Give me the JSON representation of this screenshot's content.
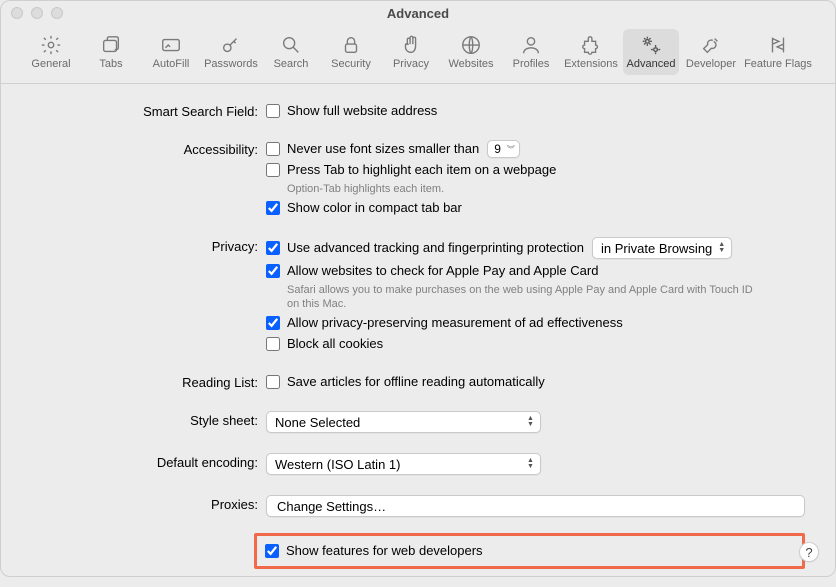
{
  "window": {
    "title": "Advanced"
  },
  "toolbar": {
    "items": [
      {
        "label": "General"
      },
      {
        "label": "Tabs"
      },
      {
        "label": "AutoFill"
      },
      {
        "label": "Passwords"
      },
      {
        "label": "Search"
      },
      {
        "label": "Security"
      },
      {
        "label": "Privacy"
      },
      {
        "label": "Websites"
      },
      {
        "label": "Profiles"
      },
      {
        "label": "Extensions"
      },
      {
        "label": "Advanced"
      },
      {
        "label": "Developer"
      },
      {
        "label": "Feature Flags"
      }
    ]
  },
  "sections": {
    "smart_search": {
      "label": "Smart Search Field:",
      "show_full_address": {
        "label": "Show full website address",
        "checked": false
      }
    },
    "accessibility": {
      "label": "Accessibility:",
      "font_size": {
        "label": "Never use font sizes smaller than",
        "checked": false,
        "value": "9"
      },
      "press_tab": {
        "label": "Press Tab to highlight each item on a webpage",
        "checked": false
      },
      "press_tab_help": "Option-Tab highlights each item.",
      "compact_color": {
        "label": "Show color in compact tab bar",
        "checked": true
      }
    },
    "privacy": {
      "label": "Privacy:",
      "tracking": {
        "label": "Use advanced tracking and fingerprinting protection",
        "checked": true,
        "mode": "in Private Browsing"
      },
      "apple_pay": {
        "label": "Allow websites to check for Apple Pay and Apple Card",
        "checked": true
      },
      "apple_pay_help": "Safari allows you to make purchases on the web using Apple Pay and Apple Card with Touch ID on this Mac.",
      "ad_measure": {
        "label": "Allow privacy-preserving measurement of ad effectiveness",
        "checked": true
      },
      "block_cookies": {
        "label": "Block all cookies",
        "checked": false
      }
    },
    "reading_list": {
      "label": "Reading List:",
      "save_offline": {
        "label": "Save articles for offline reading automatically",
        "checked": false
      }
    },
    "style_sheet": {
      "label": "Style sheet:",
      "value": "None Selected"
    },
    "default_encoding": {
      "label": "Default encoding:",
      "value": "Western (ISO Latin 1)"
    },
    "proxies": {
      "label": "Proxies:",
      "button": "Change Settings…"
    },
    "developer": {
      "label": "Show features for web developers",
      "checked": true
    }
  },
  "help": {
    "label": "?"
  }
}
